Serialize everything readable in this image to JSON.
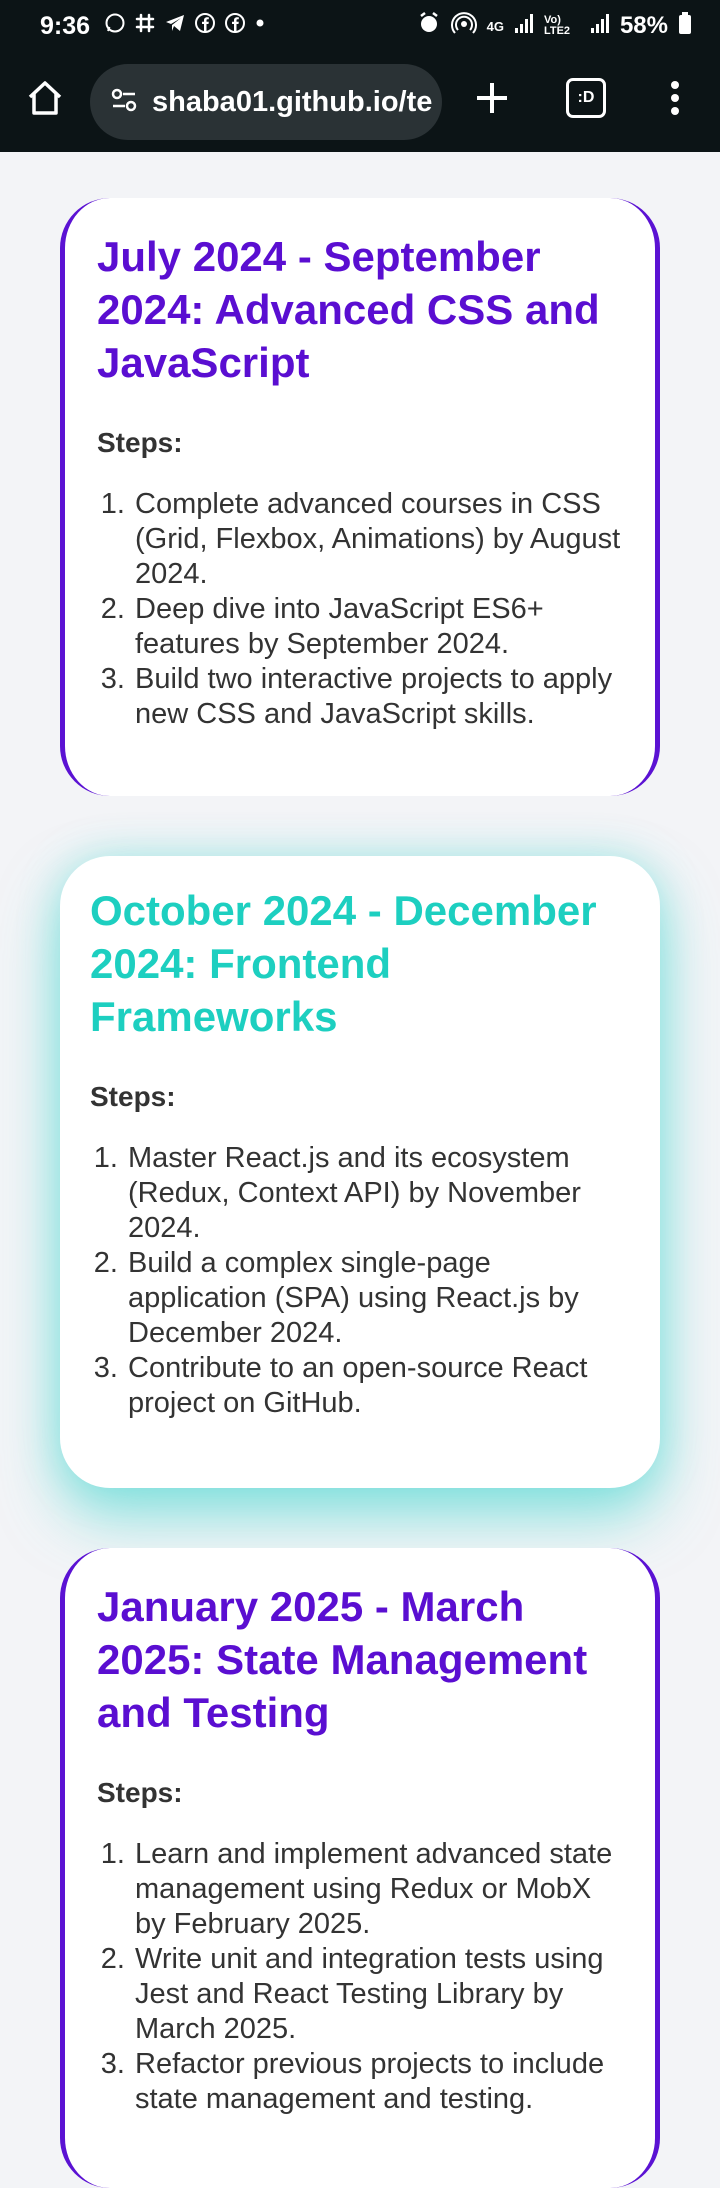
{
  "status_bar": {
    "time": "9:36",
    "battery": "58%",
    "network_label": "4G",
    "volte_label": "Vo) LTE2"
  },
  "browser": {
    "url": "shaba01.github.io/te",
    "tabs_label": ":D"
  },
  "cards": [
    {
      "title": "July 2024 - September 2024: Advanced CSS and JavaScript",
      "steps_label": "Steps:",
      "steps": [
        "Complete advanced courses in CSS (Grid, Flexbox, Animations) by August 2024.",
        "Deep dive into JavaScript ES6+ features by September 2024.",
        "Build two interactive projects to apply new CSS and JavaScript skills."
      ]
    },
    {
      "title": "October 2024 - December 2024: Frontend Frameworks",
      "steps_label": "Steps:",
      "steps": [
        "Master React.js and its ecosystem (Redux, Context API) by November 2024.",
        "Build a complex single-page application (SPA) using React.js by December 2024.",
        "Contribute to an open-source React project on GitHub."
      ]
    },
    {
      "title": "January 2025 - March 2025: State Management and Testing",
      "steps_label": "Steps:",
      "steps": [
        "Learn and implement advanced state management using Redux or MobX by February 2025.",
        "Write unit and integration tests using Jest and React Testing Library by March 2025.",
        "Refactor previous projects to include state management and testing."
      ]
    }
  ],
  "colors": {
    "purple_accent": "#5a0ed1",
    "teal_accent": "#1dcfc0",
    "chrome_bg": "#0c1416"
  }
}
